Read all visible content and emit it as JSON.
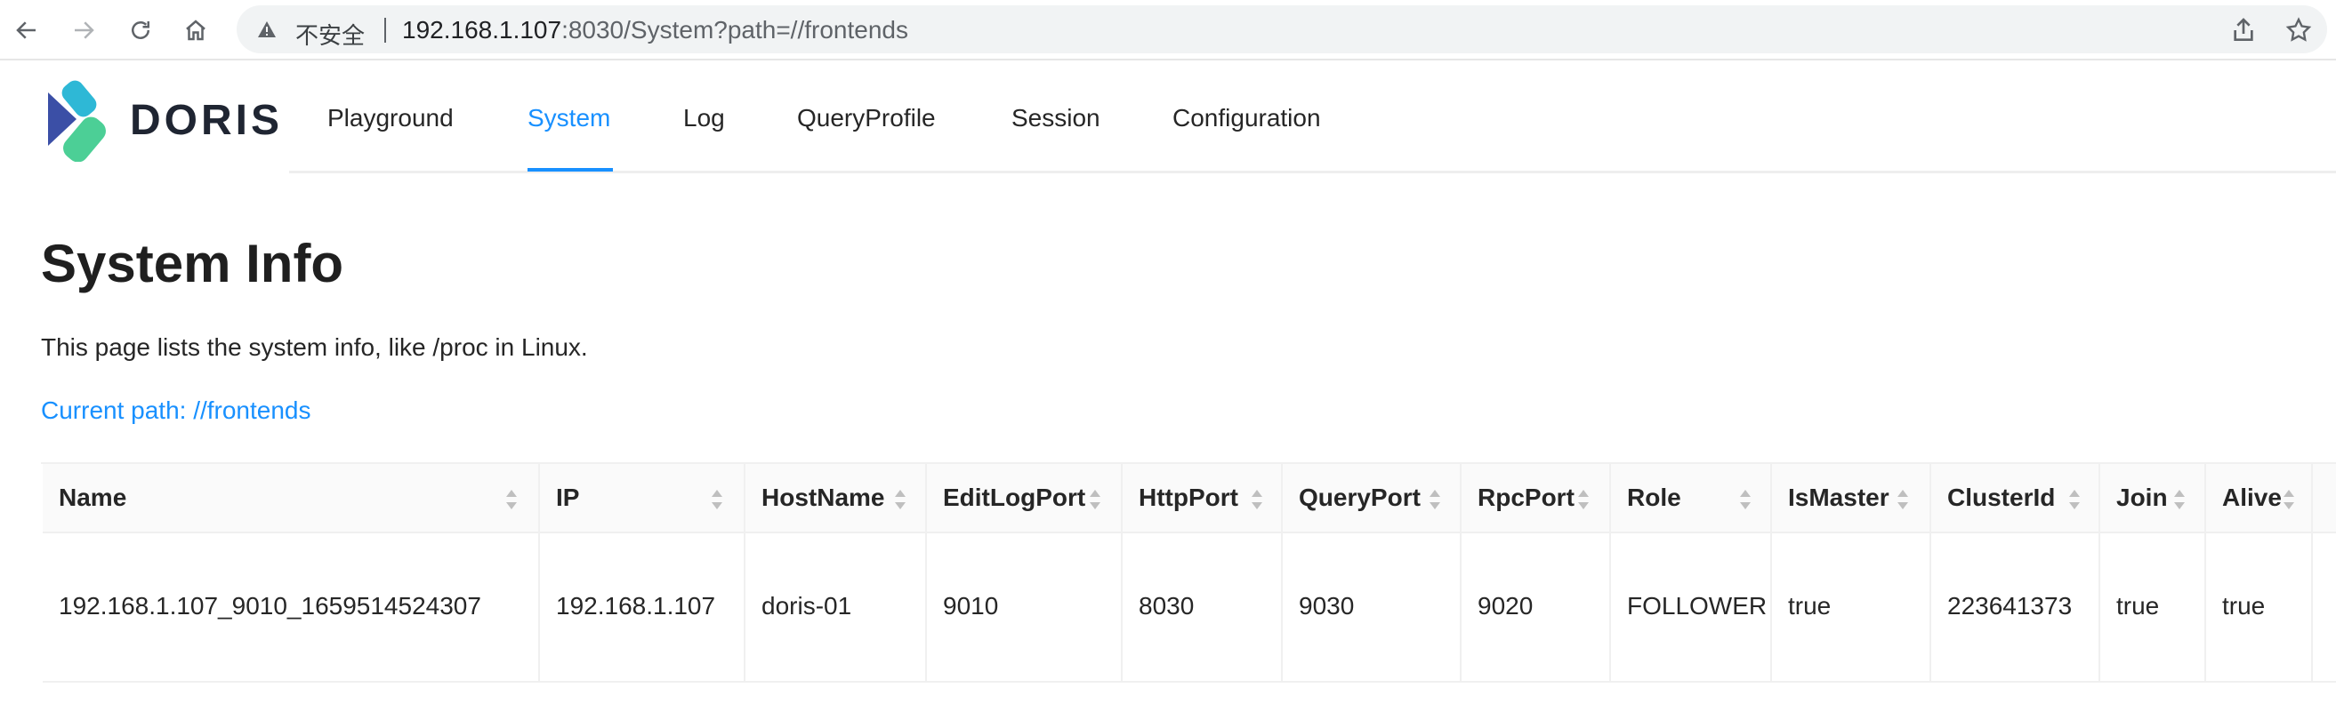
{
  "browser": {
    "insecure_label": "不安全",
    "url_host": "192.168.1.107",
    "url_rest": ":8030/System?path=//frontends",
    "icons": [
      "back-icon",
      "forward-icon",
      "reload-icon",
      "home-icon",
      "warning-icon",
      "share-icon",
      "bookmark-star-icon"
    ]
  },
  "header": {
    "logo_text": "DORIS",
    "nav": [
      {
        "label": "Playground",
        "active": false
      },
      {
        "label": "System",
        "active": true
      },
      {
        "label": "Log",
        "active": false
      },
      {
        "label": "QueryProfile",
        "active": false
      },
      {
        "label": "Session",
        "active": false
      },
      {
        "label": "Configuration",
        "active": false
      }
    ],
    "accent_color": "#1890ff"
  },
  "main": {
    "title": "System Info",
    "description": "This page lists the system info, like /proc in Linux.",
    "current_path": "Current path: //frontends"
  },
  "table": {
    "columns": [
      "Name",
      "IP",
      "HostName",
      "EditLogPort",
      "HttpPort",
      "QueryPort",
      "RpcPort",
      "Role",
      "IsMaster",
      "ClusterId",
      "Join",
      "Alive"
    ],
    "rows": [
      [
        "192.168.1.107_9010_1659514524307",
        "192.168.1.107",
        "doris-01",
        "9010",
        "8030",
        "9030",
        "9020",
        "FOLLOWER",
        "true",
        "223641373",
        "true",
        "true"
      ]
    ]
  }
}
